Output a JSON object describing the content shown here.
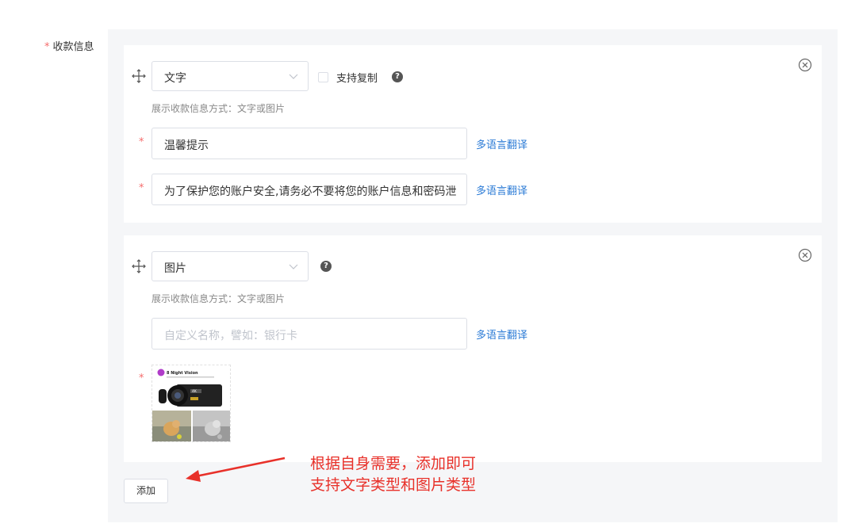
{
  "form": {
    "field_required_mark": "*",
    "field_label": "收款信息"
  },
  "cards": [
    {
      "type_value": "文字",
      "copy_checkbox_label": "支持复制",
      "copy_checked": false,
      "help_icon": "?",
      "hint": "展示收款信息方式：文字或图片",
      "required_mark": "*",
      "title_value": "温馨提示",
      "content_value": "为了保护您的账户安全,请务必不要将您的账户信息和密码泄",
      "translate_link": "多语言翻译"
    },
    {
      "type_value": "图片",
      "help_icon": "?",
      "hint": "展示收款信息方式：文字或图片",
      "name_placeholder": "自定义名称，譬如：银行卡",
      "translate_link": "多语言翻译",
      "required_mark": "*",
      "image_title": "8 Night Vision",
      "image_badge": "4K"
    }
  ],
  "add_button": "添加",
  "annotation": {
    "line1": "根据自身需要，添加即可",
    "line2": "支持文字类型和图片类型",
    "color": "#e8312a"
  },
  "icons": {
    "drag": "move-cross-icon",
    "close": "circle-x-icon",
    "select_arrow": "chevron-down-icon",
    "help": "question-circle-icon"
  },
  "colors": {
    "link": "#2b7bd6",
    "required": "#f56c6c",
    "panel_bg": "#f5f6f8"
  }
}
